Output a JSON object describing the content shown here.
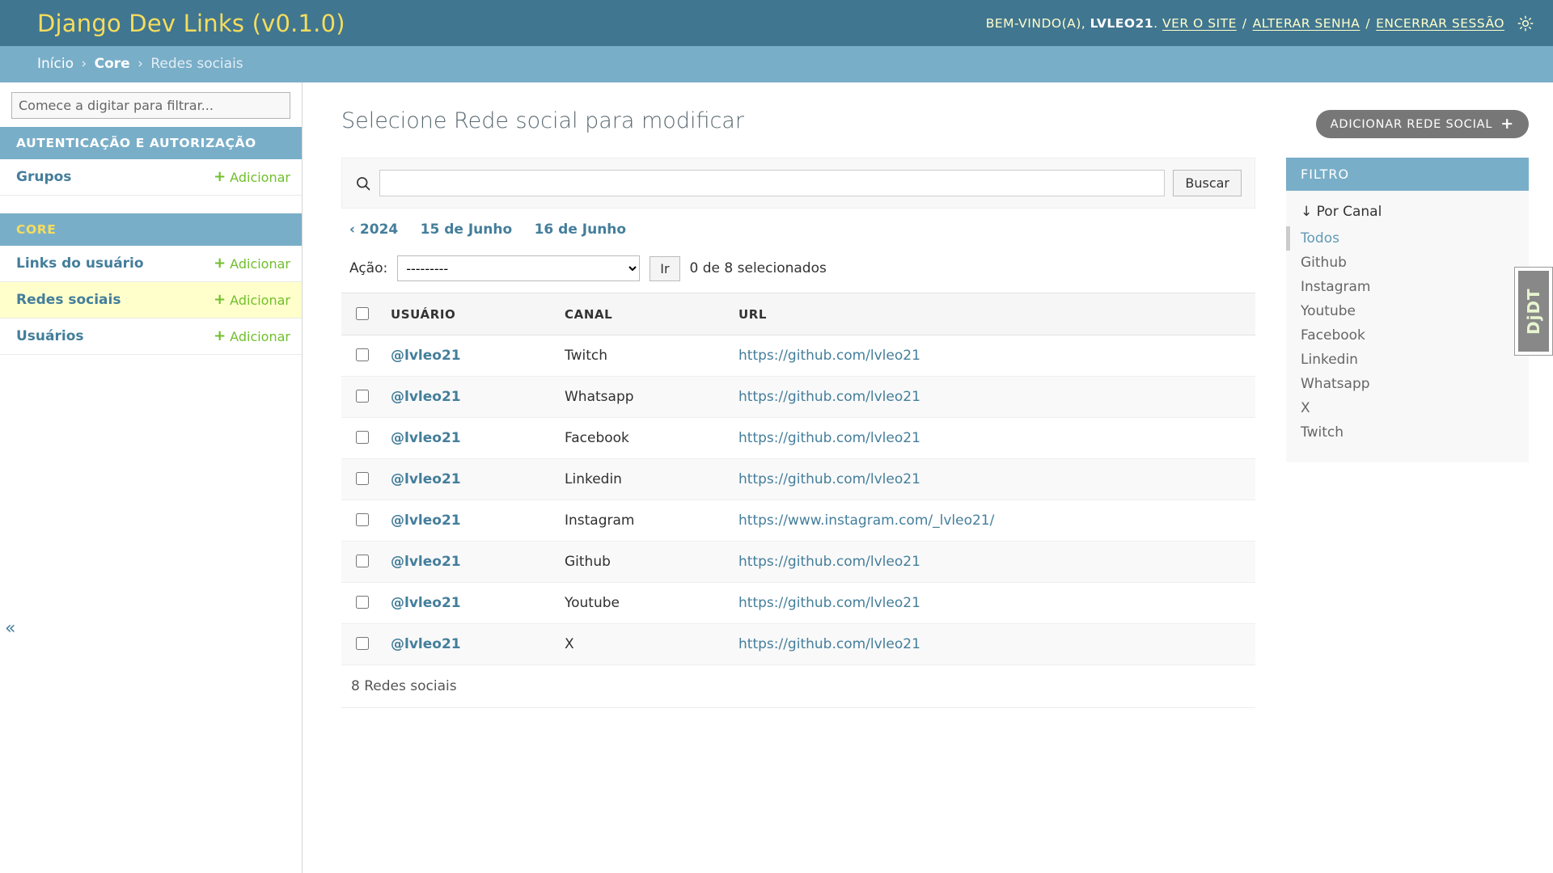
{
  "header": {
    "site_title": "Django Dev Links (v0.1.0)",
    "welcome_prefix": "BEM-VINDO(A),",
    "username": "LVLEO21",
    "username_suffix": ".",
    "links": [
      {
        "label": "VER O SITE"
      },
      {
        "label": "ALTERAR SENHA"
      },
      {
        "label": "ENCERRAR SESSÃO"
      }
    ],
    "separator": "/",
    "theme_icon": "sun-icon"
  },
  "breadcrumbs": {
    "items": [
      {
        "label": "Início",
        "bold": false,
        "link": true
      },
      {
        "label": "Core",
        "bold": true,
        "link": true
      },
      {
        "label": "Redes sociais",
        "bold": false,
        "link": false
      }
    ],
    "separator": "›"
  },
  "sidebar": {
    "filter_placeholder": "Comece a digitar para filtrar...",
    "filter_value": "",
    "collapse_icon": "«",
    "apps": [
      {
        "caption": "AUTENTICAÇÃO E AUTORIZAÇÃO",
        "models": [
          {
            "label": "Grupos",
            "add_label": "Adicionar",
            "current": false
          }
        ]
      },
      {
        "caption": "CORE",
        "models": [
          {
            "label": "Links do usuário",
            "add_label": "Adicionar",
            "current": false
          },
          {
            "label": "Redes sociais",
            "add_label": "Adicionar",
            "current": true
          },
          {
            "label": "Usuários",
            "add_label": "Adicionar",
            "current": false
          }
        ]
      }
    ],
    "add_plus": "+"
  },
  "content": {
    "title": "Selecione Rede social para modificar",
    "add_button": {
      "label": "ADICIONAR REDE SOCIAL",
      "plus": "+"
    },
    "search": {
      "icon": "search-icon",
      "value": "",
      "placeholder": "",
      "submit_label": "Buscar"
    },
    "date_hierarchy": [
      {
        "label": "‹ 2024",
        "back": true
      },
      {
        "label": "15 de Junho",
        "back": false
      },
      {
        "label": "16 de Junho",
        "back": false
      }
    ],
    "actions": {
      "label": "Ação:",
      "selected_option": "---------",
      "options": [
        "---------"
      ],
      "go_label": "Ir",
      "counter": "0 de 8 selecionados"
    },
    "table": {
      "columns": [
        "USUÁRIO",
        "CANAL",
        "URL"
      ],
      "rows": [
        {
          "user": "@lvleo21",
          "canal": "Twitch",
          "url": "https://github.com/lvleo21"
        },
        {
          "user": "@lvleo21",
          "canal": "Whatsapp",
          "url": "https://github.com/lvleo21"
        },
        {
          "user": "@lvleo21",
          "canal": "Facebook",
          "url": "https://github.com/lvleo21"
        },
        {
          "user": "@lvleo21",
          "canal": "Linkedin",
          "url": "https://github.com/lvleo21"
        },
        {
          "user": "@lvleo21",
          "canal": "Instagram",
          "url": "https://www.instagram.com/_lvleo21/"
        },
        {
          "user": "@lvleo21",
          "canal": "Github",
          "url": "https://github.com/lvleo21"
        },
        {
          "user": "@lvleo21",
          "canal": "Youtube",
          "url": "https://github.com/lvleo21"
        },
        {
          "user": "@lvleo21",
          "canal": "X",
          "url": "https://github.com/lvleo21"
        }
      ]
    },
    "paginator": "8 Redes sociais"
  },
  "filter_panel": {
    "title": "FILTRO",
    "group_title": "↓ Por Canal",
    "options": [
      {
        "label": "Todos",
        "selected": true
      },
      {
        "label": "Github",
        "selected": false
      },
      {
        "label": "Instagram",
        "selected": false
      },
      {
        "label": "Youtube",
        "selected": false
      },
      {
        "label": "Facebook",
        "selected": false
      },
      {
        "label": "Linkedin",
        "selected": false
      },
      {
        "label": "Whatsapp",
        "selected": false
      },
      {
        "label": "X",
        "selected": false
      },
      {
        "label": "Twitch",
        "selected": false
      }
    ]
  },
  "debug_toolbar": {
    "label": "DjDT"
  },
  "colors": {
    "header_bg": "#417690",
    "breadcrumb_bg": "#79aec8",
    "brand_yellow": "#f5dd5d",
    "link_blue": "#447e9b",
    "add_green": "#70bf2b",
    "current_row": "#ffffcc",
    "button_gray": "#777777"
  }
}
